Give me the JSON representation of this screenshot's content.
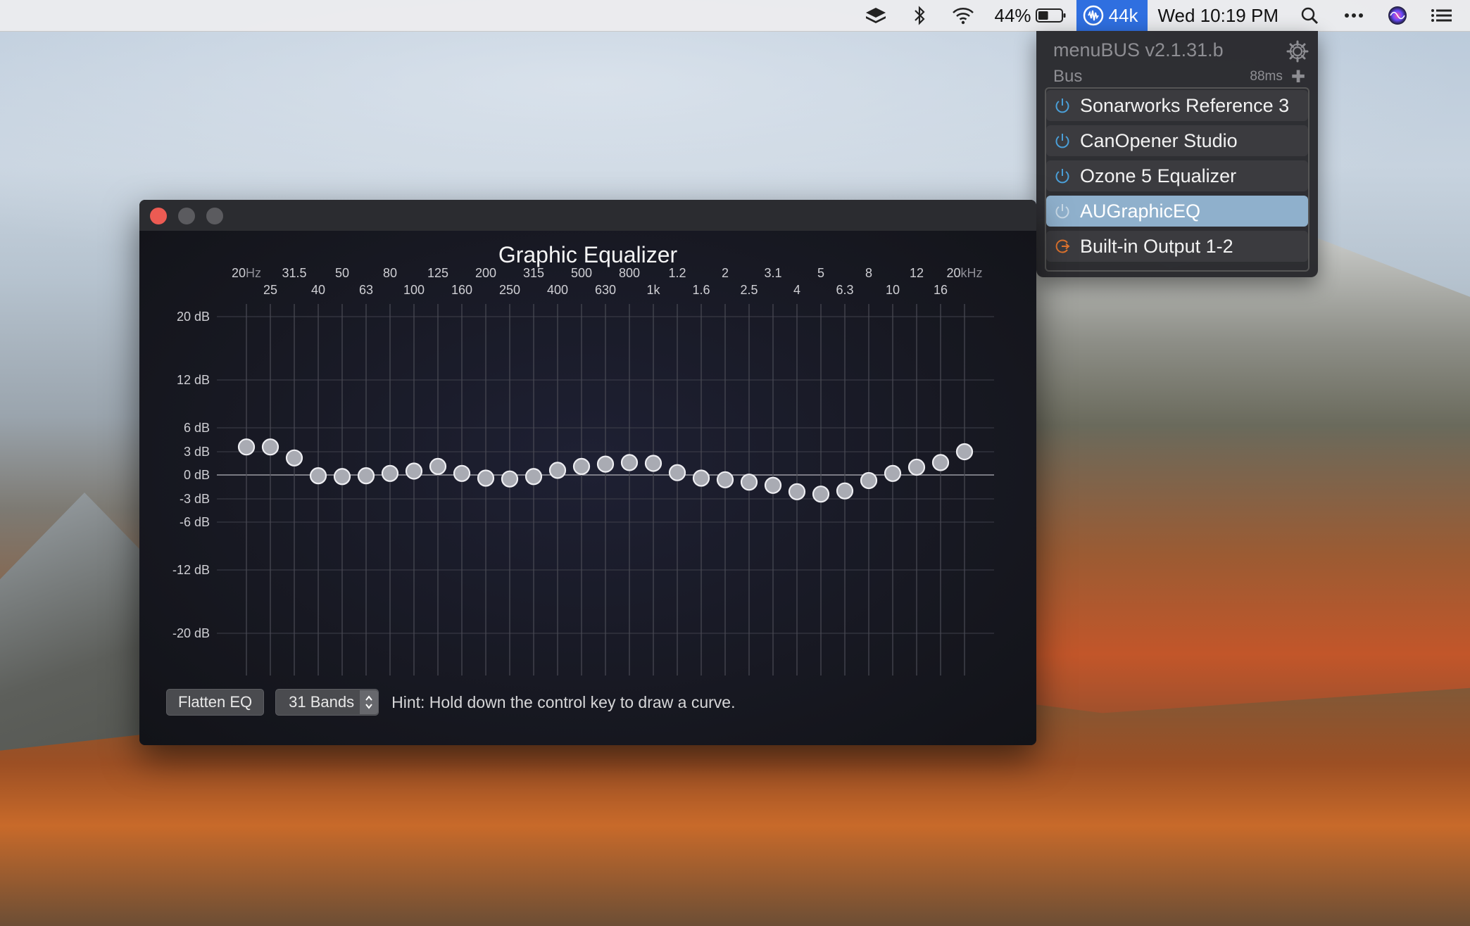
{
  "menubar": {
    "battery_percent": "44%",
    "battery_level": 0.44,
    "sample_rate": "44k",
    "clock": "Wed 10:19 PM"
  },
  "menubus": {
    "title": "menuBUS v2.1.31.b",
    "bus_label": "Bus",
    "latency": "88ms",
    "items": [
      {
        "label": "Sonarworks Reference 3",
        "icon": "power-icon",
        "selected": false
      },
      {
        "label": "CanOpener Studio",
        "icon": "power-icon",
        "selected": false
      },
      {
        "label": "Ozone 5 Equalizer",
        "icon": "power-icon",
        "selected": false
      },
      {
        "label": "AUGraphicEQ",
        "icon": "power-icon",
        "selected": true
      },
      {
        "label": "Built-in Output 1-2",
        "icon": "output-icon",
        "selected": false
      }
    ],
    "colors": {
      "selected": "#8fb0cc",
      "power": "#4a9fd8",
      "output": "#e0742e"
    }
  },
  "eq": {
    "title": "Graphic Equalizer",
    "freq_top": [
      "20",
      "31.5",
      "50",
      "80",
      "125",
      "200",
      "315",
      "500",
      "800",
      "1.2",
      "2",
      "3.1",
      "5",
      "8",
      "12",
      "20"
    ],
    "freq_top_units": {
      "first": "Hz",
      "last": "kHz"
    },
    "freq_bottom": [
      "25",
      "40",
      "63",
      "100",
      "160",
      "250",
      "400",
      "630",
      "1k",
      "1.6",
      "2.5",
      "4",
      "6.3",
      "10",
      "16"
    ],
    "db_labels": [
      {
        "value": 20,
        "text": "20 dB"
      },
      {
        "value": 12,
        "text": "12 dB"
      },
      {
        "value": 6,
        "text": "6 dB"
      },
      {
        "value": 3,
        "text": "3 dB"
      },
      {
        "value": 0,
        "text": "0 dB"
      },
      {
        "value": -3,
        "text": "-3 dB"
      },
      {
        "value": -6,
        "text": "-6 dB"
      },
      {
        "value": -12,
        "text": "-12 dB"
      },
      {
        "value": -20,
        "text": "-20 dB"
      }
    ],
    "band_gains_db": [
      3.6,
      3.6,
      2.2,
      -0.1,
      -0.2,
      -0.1,
      0.2,
      0.5,
      1.1,
      0.2,
      -0.4,
      -0.5,
      -0.2,
      0.6,
      1.1,
      1.4,
      1.6,
      1.5,
      0.3,
      -0.4,
      -0.6,
      -0.9,
      -1.3,
      -2.1,
      -2.4,
      -2.0,
      -0.7,
      0.2,
      1.0,
      1.6,
      3.0
    ],
    "flatten_label": "Flatten EQ",
    "bands_option": "31 Bands",
    "hint": "Hint: Hold down the control key to draw a curve."
  }
}
